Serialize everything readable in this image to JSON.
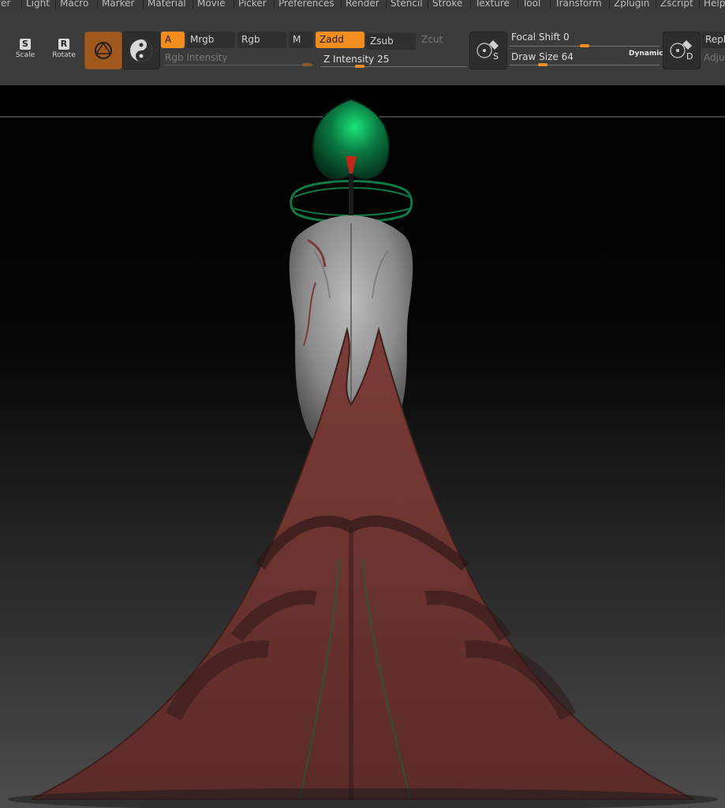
{
  "menus": [
    {
      "name": "layer",
      "label": "yer"
    },
    {
      "name": "light",
      "label": "Light"
    },
    {
      "name": "macro",
      "label": "Macro"
    },
    {
      "name": "marker",
      "label": "Marker"
    },
    {
      "name": "material",
      "label": "Material"
    },
    {
      "name": "movie",
      "label": "Movie"
    },
    {
      "name": "picker",
      "label": "Picker"
    },
    {
      "name": "preferences",
      "label": "Preferences"
    },
    {
      "name": "render",
      "label": "Render"
    },
    {
      "name": "stencil",
      "label": "Stencil"
    },
    {
      "name": "stroke",
      "label": "Stroke"
    },
    {
      "name": "texture",
      "label": "Texture"
    },
    {
      "name": "tool",
      "label": "Tool"
    },
    {
      "name": "transform",
      "label": "Transform"
    },
    {
      "name": "zplugin",
      "label": "Zplugin"
    },
    {
      "name": "zscript",
      "label": "Zscript"
    },
    {
      "name": "help",
      "label": "Help"
    }
  ],
  "shelf": {
    "scale": {
      "key": "S",
      "label": "Scale"
    },
    "rotate": {
      "key": "R",
      "label": "Rotate"
    },
    "a_button": "A",
    "mrgb": "Mrgb",
    "rgb": "Rgb",
    "m": "M",
    "rgb_intensity_label": "Rgb Intensity",
    "zadd": "Zadd",
    "zsub": "Zsub",
    "zcut": "Zcut",
    "z_intensity": {
      "label": "Z Intensity",
      "value": "25",
      "fraction": 0.25
    },
    "focal_shift": {
      "label": "Focal Shift",
      "value": "0",
      "fraction": 0.5
    },
    "draw_size": {
      "label": "Draw Size",
      "value": "64",
      "fraction": 0.2
    },
    "dynamic": "Dynamic",
    "s_key": "S",
    "d_key": "D",
    "replay": "Repl",
    "adjust": "Adju"
  },
  "colors": {
    "accent": "#f28d22",
    "panel": "#3b3b3b",
    "field": "#2f2f2f",
    "model_red": "#7a3b36",
    "model_gray": "#9a9a9a",
    "green": "#0f6b3f"
  }
}
